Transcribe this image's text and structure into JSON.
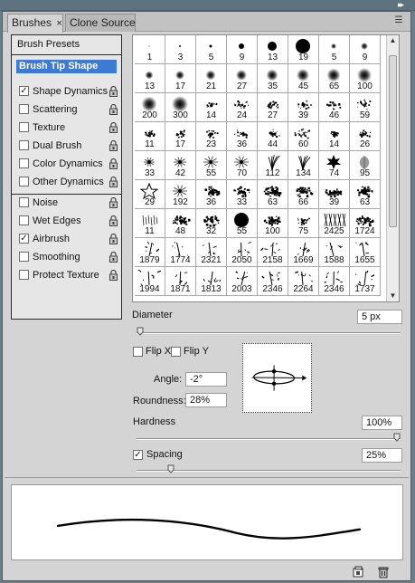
{
  "tabs": [
    {
      "label": "Brushes",
      "close": "×"
    },
    {
      "label": "Clone Source"
    }
  ],
  "options": {
    "presets_label": "Brush Presets",
    "tip_shape_label": "Brush Tip Shape",
    "items": [
      {
        "label": "Shape Dynamics",
        "checked": true,
        "lock": true
      },
      {
        "label": "Scattering",
        "checked": false,
        "lock": true
      },
      {
        "label": "Texture",
        "checked": false,
        "lock": true
      },
      {
        "label": "Dual Brush",
        "checked": false,
        "lock": true
      },
      {
        "label": "Color Dynamics",
        "checked": false,
        "lock": true
      },
      {
        "label": "Other Dynamics",
        "checked": false,
        "lock": true
      },
      {
        "label": "Noise",
        "checked": false,
        "lock": true
      },
      {
        "label": "Wet Edges",
        "checked": false,
        "lock": true
      },
      {
        "label": "Airbrush",
        "checked": true,
        "lock": true
      },
      {
        "label": "Smoothing",
        "checked": false,
        "lock": true
      },
      {
        "label": "Protect Texture",
        "checked": false,
        "lock": true
      }
    ]
  },
  "brushes": [
    {
      "size": "1",
      "kind": "hard",
      "d": 1
    },
    {
      "size": "3",
      "kind": "hard",
      "d": 2
    },
    {
      "size": "5",
      "kind": "hard",
      "d": 3
    },
    {
      "size": "9",
      "kind": "hard",
      "d": 6
    },
    {
      "size": "13",
      "kind": "hard",
      "d": 10
    },
    {
      "size": "19",
      "kind": "hard",
      "d": 16
    },
    {
      "size": "5",
      "kind": "soft",
      "d": 4
    },
    {
      "size": "9",
      "kind": "soft",
      "d": 6
    },
    {
      "size": "13",
      "kind": "soft",
      "d": 7
    },
    {
      "size": "17",
      "kind": "soft",
      "d": 8
    },
    {
      "size": "21",
      "kind": "soft",
      "d": 9
    },
    {
      "size": "27",
      "kind": "soft",
      "d": 10
    },
    {
      "size": "35",
      "kind": "soft",
      "d": 11
    },
    {
      "size": "45",
      "kind": "soft",
      "d": 12
    },
    {
      "size": "65",
      "kind": "soft",
      "d": 13
    },
    {
      "size": "100",
      "kind": "soft",
      "d": 14
    },
    {
      "size": "200",
      "kind": "soft",
      "d": 15
    },
    {
      "size": "300",
      "kind": "soft",
      "d": 16
    },
    {
      "size": "14",
      "kind": "spatter",
      "d": 12
    },
    {
      "size": "24",
      "kind": "spatter",
      "d": 14
    },
    {
      "size": "27",
      "kind": "spatter",
      "d": 14
    },
    {
      "size": "39",
      "kind": "spatter",
      "d": 15
    },
    {
      "size": "46",
      "kind": "spatter",
      "d": 15
    },
    {
      "size": "59",
      "kind": "spatter",
      "d": 16
    },
    {
      "size": "11",
      "kind": "spatter",
      "d": 10
    },
    {
      "size": "17",
      "kind": "spatter",
      "d": 12
    },
    {
      "size": "23",
      "kind": "spatter",
      "d": 13
    },
    {
      "size": "36",
      "kind": "spatter",
      "d": 15
    },
    {
      "size": "44",
      "kind": "spatter",
      "d": 16
    },
    {
      "size": "60",
      "kind": "spatter",
      "d": 16
    },
    {
      "size": "14",
      "kind": "spatter",
      "d": 8
    },
    {
      "size": "26",
      "kind": "spatter",
      "d": 12
    },
    {
      "size": "33",
      "kind": "star-soft",
      "d": 12
    },
    {
      "size": "42",
      "kind": "star-soft",
      "d": 14
    },
    {
      "size": "55",
      "kind": "star-soft",
      "d": 16
    },
    {
      "size": "70",
      "kind": "star-soft",
      "d": 16
    },
    {
      "size": "112",
      "kind": "grass",
      "d": 16
    },
    {
      "size": "134",
      "kind": "grass",
      "d": 16
    },
    {
      "size": "74",
      "kind": "leaf",
      "d": 16
    },
    {
      "size": "95",
      "kind": "leaf-soft",
      "d": 16
    },
    {
      "size": "29",
      "kind": "star",
      "d": 16
    },
    {
      "size": "192",
      "kind": "star-soft",
      "d": 16
    },
    {
      "size": "36",
      "kind": "texture",
      "d": 16
    },
    {
      "size": "33",
      "kind": "texture",
      "d": 16
    },
    {
      "size": "63",
      "kind": "texture",
      "d": 16
    },
    {
      "size": "66",
      "kind": "texture",
      "d": 16
    },
    {
      "size": "39",
      "kind": "texture",
      "d": 16
    },
    {
      "size": "63",
      "kind": "texture",
      "d": 16
    },
    {
      "size": "11",
      "kind": "dash",
      "d": 14
    },
    {
      "size": "48",
      "kind": "texture",
      "d": 16
    },
    {
      "size": "32",
      "kind": "texture",
      "d": 16
    },
    {
      "size": "55",
      "kind": "hard",
      "d": 16
    },
    {
      "size": "100",
      "kind": "texture",
      "d": 16
    },
    {
      "size": "75",
      "kind": "spatter",
      "d": 14
    },
    {
      "size": "2425",
      "kind": "lines",
      "d": 16
    },
    {
      "size": "1724",
      "kind": "texture",
      "d": 16
    },
    {
      "size": "1879",
      "kind": "branch",
      "d": 16
    },
    {
      "size": "1774",
      "kind": "branch",
      "d": 16
    },
    {
      "size": "2321",
      "kind": "branch",
      "d": 16
    },
    {
      "size": "2050",
      "kind": "branch",
      "d": 16
    },
    {
      "size": "2158",
      "kind": "branch",
      "d": 16
    },
    {
      "size": "1669",
      "kind": "branch",
      "d": 16
    },
    {
      "size": "1588",
      "kind": "branch",
      "d": 16
    },
    {
      "size": "1655",
      "kind": "branch",
      "d": 16
    },
    {
      "size": "1994",
      "kind": "branch",
      "d": 16
    },
    {
      "size": "1871",
      "kind": "branch",
      "d": 16
    },
    {
      "size": "1813",
      "kind": "branch",
      "d": 16
    },
    {
      "size": "2003",
      "kind": "branch",
      "d": 16
    },
    {
      "size": "2346",
      "kind": "branch",
      "d": 16
    },
    {
      "size": "2264",
      "kind": "branch",
      "d": 16
    },
    {
      "size": "2346",
      "kind": "branch",
      "d": 16
    },
    {
      "size": "1737",
      "kind": "branch",
      "d": 16
    }
  ],
  "settings": {
    "diameter_label": "Diameter",
    "diameter_value": "5 px",
    "diameter_slider": 0.0,
    "flip_x_label": "Flip X",
    "flip_y_label": "Flip Y",
    "flip_x": false,
    "flip_y": false,
    "angle_label": "Angle:",
    "angle_value": "-2°",
    "roundness_label": "Roundness:",
    "roundness_value": "28%",
    "hardness_label": "Hardness",
    "hardness_value": "100%",
    "hardness_slider": 1.0,
    "spacing_label": "Spacing",
    "spacing_checked": true,
    "spacing_value": "25%",
    "spacing_slider": 0.12
  },
  "icons": {
    "panel_menu": "panel-menu-icon",
    "collapse": "collapse-panel-icon",
    "lock": "lock-icon",
    "new": "new-preset-icon",
    "trash": "trash-icon"
  },
  "colors": {
    "selected": "#3d7ad6",
    "panel": "#d4d4d4"
  }
}
